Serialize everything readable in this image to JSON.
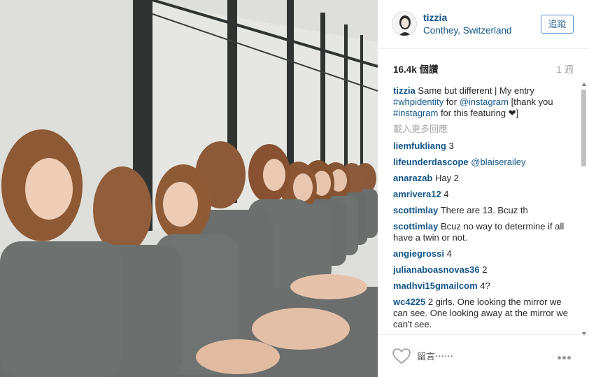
{
  "post": {
    "photo_alt": "",
    "username": "tizzia",
    "location": "Conthey, Switzerland",
    "follow_label": "追蹤",
    "views": "16.4k 個讚",
    "time_ago": "1 週",
    "load_more": "載入更多回應"
  },
  "caption": {
    "username": "tizzia",
    "text_1": "Same but different | My entry",
    "hashtag_1": "#whpidentity",
    "text_2": "for",
    "mention_1": "@instagram",
    "text_3": "[thank you",
    "hashtag_2": "#instagram",
    "text_4": "for this featuring ❤]"
  },
  "comments": [
    {
      "user": "liemfukliang",
      "text": "3"
    },
    {
      "user": "lifeunderdascope",
      "text": "@blaiserailey",
      "is_mention": true
    },
    {
      "user": "anarazab",
      "text": "Hay 2"
    },
    {
      "user": "amrivera12",
      "text": "4"
    },
    {
      "user": "scottimlay",
      "text": "There are 13. Bcuz th"
    },
    {
      "user": "scottimlay",
      "text": "Bcuz no way to determine if all have a twin or not."
    },
    {
      "user": "angiegrossi",
      "text": "4"
    },
    {
      "user": "julianaboasnovas36",
      "text": "2"
    },
    {
      "user": "madhvi15gmailcom",
      "text": "4?"
    },
    {
      "user": "wc4225",
      "text": "2 girls. One looking the mirror we can see. One looking away at the mirror we can't see."
    }
  ],
  "footer": {
    "comment_placeholder": "留言⋯⋯",
    "like_icon": "heart-outline-icon",
    "more_icon": "ellipsis-icon"
  },
  "colors": {
    "link": "#125688",
    "muted": "#a5a7aa",
    "follow_border": "#4e8fcc"
  }
}
